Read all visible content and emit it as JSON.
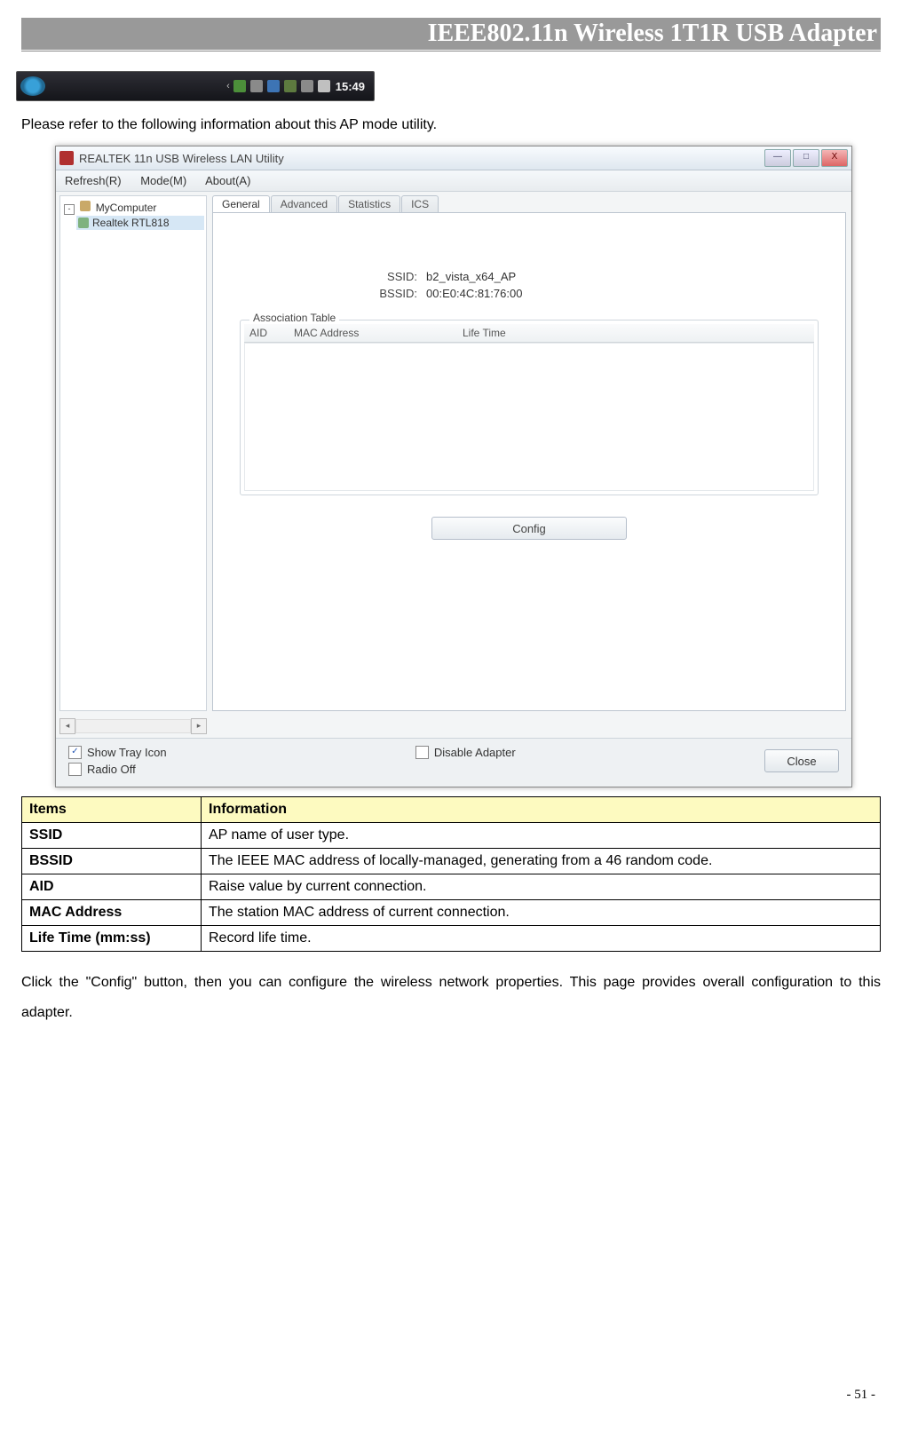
{
  "header": {
    "title": "IEEE802.11n Wireless 1T1R USB Adapter"
  },
  "taskbar": {
    "clock": "15:49"
  },
  "intro": "Please refer to the following information about this AP mode utility.",
  "window": {
    "title": "REALTEK 11n USB Wireless LAN Utility",
    "menu": {
      "refresh": "Refresh(R)",
      "mode": "Mode(M)",
      "about": "About(A)"
    },
    "tree": {
      "root": "MyComputer",
      "child": "Realtek RTL818"
    },
    "tabs": {
      "general": "General",
      "advanced": "Advanced",
      "statistics": "Statistics",
      "ics": "ICS"
    },
    "fields": {
      "ssid_label": "SSID:",
      "ssid_value": "b2_vista_x64_AP",
      "bssid_label": "BSSID:",
      "bssid_value": "00:E0:4C:81:76:00"
    },
    "assoc": {
      "legend": "Association Table",
      "aid": "AID",
      "mac": "MAC Address",
      "life": "Life Time"
    },
    "config_button": "Config",
    "bottom": {
      "show_tray": "Show Tray Icon",
      "radio_off": "Radio Off",
      "disable_adapter": "Disable Adapter",
      "close": "Close"
    },
    "controls": {
      "min": "—",
      "max": "□",
      "close": "X"
    }
  },
  "tableheaders": {
    "items": "Items",
    "info": "Information"
  },
  "rows": {
    "ssid": {
      "k": "SSID",
      "v": "AP name of user type."
    },
    "bssid": {
      "k": "BSSID",
      "v": "The IEEE MAC address of locally-managed, generating from a 46 random code."
    },
    "aid": {
      "k": "AID",
      "v": "Raise value by current connection."
    },
    "mac": {
      "k": "MAC Address",
      "v": "The station MAC address of current connection."
    },
    "life": {
      "k": "Life Time (mm:ss)",
      "v": "Record life time."
    }
  },
  "outro": "Click the \"Config\" button, then you can configure the wireless network properties. This page provides overall configuration to this adapter.",
  "page_number": "- 51 -"
}
